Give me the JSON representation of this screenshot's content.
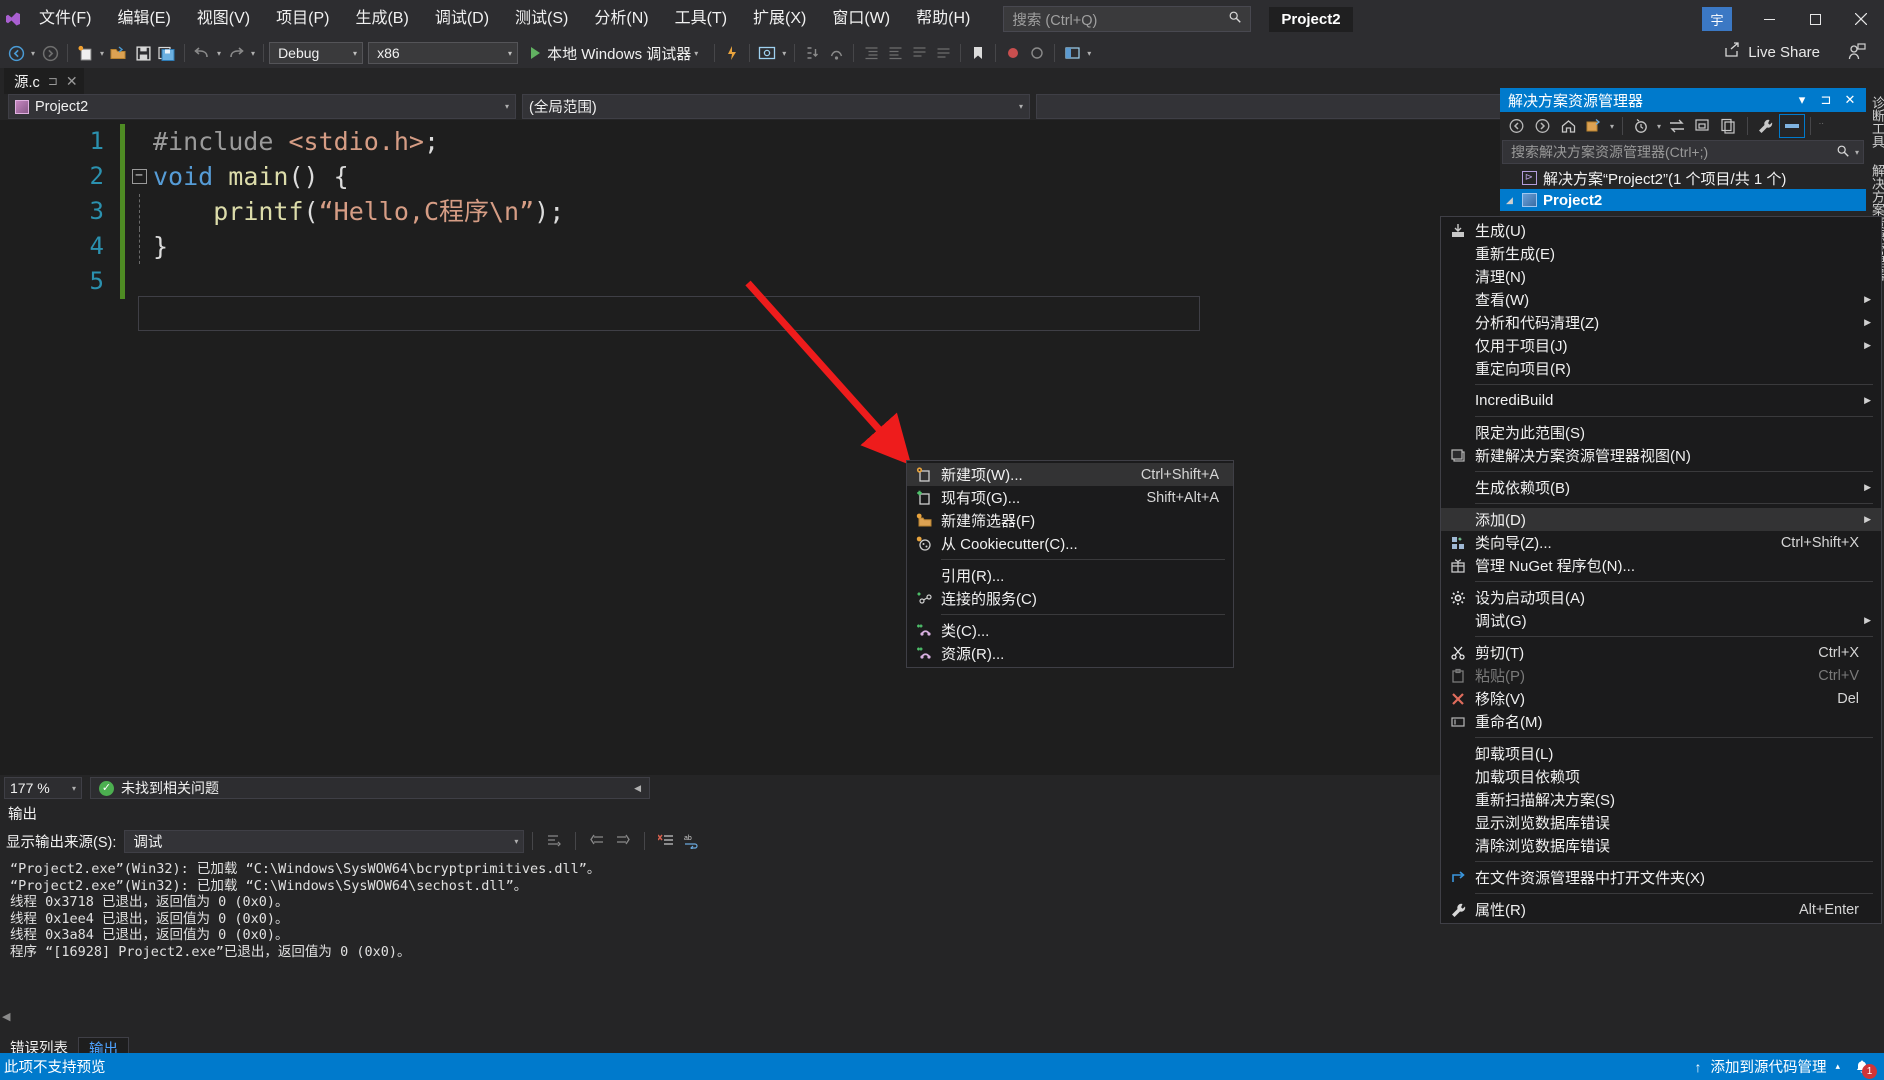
{
  "titlebar": {
    "menus": [
      "文件(F)",
      "编辑(E)",
      "视图(V)",
      "项目(P)",
      "生成(B)",
      "调试(D)",
      "测试(S)",
      "分析(N)",
      "工具(T)",
      "扩展(X)",
      "窗口(W)",
      "帮助(H)"
    ],
    "search_placeholder": "搜索 (Ctrl+Q)",
    "project_pill": "Project2",
    "user_initial": "宇",
    "minimize": "—",
    "maximize": "□",
    "close": "✕"
  },
  "toolbar": {
    "config": "Debug",
    "platform": "x86",
    "run_label": "本地 Windows 调试器",
    "live_share": "Live Share",
    "accent": "#007acc"
  },
  "editor": {
    "tab_name": "源.c",
    "nav_project": "Project2",
    "nav_scope": "(全局范围)",
    "nav_member": "",
    "lines": [
      {
        "num": "1",
        "fold": "",
        "indent": false,
        "tokens": [
          {
            "t": "#include ",
            "c": "c-pp"
          },
          {
            "t": "<stdio.h>",
            "c": "c-inc"
          },
          {
            "t": ";",
            "c": "c-plain"
          }
        ]
      },
      {
        "num": "2",
        "fold": "minus",
        "indent": false,
        "tokens": [
          {
            "t": "void",
            "c": "c-kw"
          },
          {
            "t": " ",
            "c": "c-plain"
          },
          {
            "t": "main",
            "c": "c-fn"
          },
          {
            "t": "() {",
            "c": "c-plain"
          }
        ]
      },
      {
        "num": "3",
        "fold": "",
        "indent": true,
        "tokens": [
          {
            "t": "    ",
            "c": "c-plain"
          },
          {
            "t": "printf",
            "c": "c-fn"
          },
          {
            "t": "(",
            "c": "c-plain"
          },
          {
            "t": "“Hello,C程序\\n”",
            "c": "c-str"
          },
          {
            "t": ");",
            "c": "c-plain"
          }
        ]
      },
      {
        "num": "4",
        "fold": "",
        "indent": true,
        "tokens": [
          {
            "t": "}",
            "c": "c-plain"
          }
        ]
      },
      {
        "num": "5",
        "fold": "",
        "indent": false,
        "tokens": []
      }
    ],
    "zoom_level": "177 %",
    "issues_text": "未找到相关问题",
    "ok_mark": "✓"
  },
  "output": {
    "title": "输出",
    "source_label": "显示输出来源(S):",
    "source_value": "调试",
    "lines": [
      "“Project2.exe”(Win32): 已加载 “C:\\Windows\\SysWOW64\\bcryptprimitives.dll”。",
      "“Project2.exe”(Win32): 已加载 “C:\\Windows\\SysWOW64\\sechost.dll”。",
      "线程 0x3718 已退出，返回值为 0 (0x0)。",
      "线程 0x1ee4 已退出，返回值为 0 (0x0)。",
      "线程 0x3a84 已退出，返回值为 0 (0x0)。",
      "程序 “[16928] Project2.exe”已退出，返回值为 0 (0x0)。"
    ],
    "tabs": [
      {
        "label": "错误列表",
        "active": false
      },
      {
        "label": "输出",
        "active": true
      }
    ]
  },
  "solution_explorer": {
    "title": "解决方案资源管理器",
    "search_placeholder": "搜索解决方案资源管理器(Ctrl+;)",
    "solution_row": "解决方案“Project2”(1 个项目/共 1 个)",
    "project_row": "Project2",
    "header_buttons": [
      "chevron-down-icon",
      "pin-icon",
      "close-icon"
    ]
  },
  "vertical_tabs": [
    "诊断工具",
    "解决方案资源管理器"
  ],
  "context_menu": {
    "items": [
      {
        "label": "生成(U)",
        "key": "",
        "icon": "build-icon",
        "submenu": false,
        "disabled": false,
        "hl": false
      },
      {
        "label": "重新生成(E)",
        "key": "",
        "icon": "",
        "submenu": false,
        "disabled": false,
        "hl": false
      },
      {
        "label": "清理(N)",
        "key": "",
        "icon": "",
        "submenu": false,
        "disabled": false,
        "hl": false
      },
      {
        "label": "查看(W)",
        "key": "",
        "icon": "",
        "submenu": true,
        "disabled": false,
        "hl": false
      },
      {
        "label": "分析和代码清理(Z)",
        "key": "",
        "icon": "",
        "submenu": true,
        "disabled": false,
        "hl": false
      },
      {
        "label": "仅用于项目(J)",
        "key": "",
        "icon": "",
        "submenu": true,
        "disabled": false,
        "hl": false
      },
      {
        "label": "重定向项目(R)",
        "key": "",
        "icon": "",
        "submenu": false,
        "disabled": false,
        "hl": false
      },
      {
        "separator": true
      },
      {
        "label": "IncrediBuild",
        "key": "",
        "icon": "",
        "submenu": true,
        "disabled": false,
        "hl": false
      },
      {
        "separator": true
      },
      {
        "label": "限定为此范围(S)",
        "key": "",
        "icon": "",
        "submenu": false,
        "disabled": false,
        "hl": false
      },
      {
        "label": "新建解决方案资源管理器视图(N)",
        "key": "",
        "icon": "new-view-icon",
        "submenu": false,
        "disabled": false,
        "hl": false
      },
      {
        "separator": true
      },
      {
        "label": "生成依赖项(B)",
        "key": "",
        "icon": "",
        "submenu": true,
        "disabled": false,
        "hl": false
      },
      {
        "separator": true
      },
      {
        "label": "添加(D)",
        "key": "",
        "icon": "",
        "submenu": true,
        "disabled": false,
        "hl": true
      },
      {
        "label": "类向导(Z)...",
        "key": "Ctrl+Shift+X",
        "icon": "class-wizard-icon",
        "submenu": false,
        "disabled": false,
        "hl": false
      },
      {
        "label": "管理 NuGet 程序包(N)...",
        "key": "",
        "icon": "nuget-icon",
        "submenu": false,
        "disabled": false,
        "hl": false
      },
      {
        "separator": true
      },
      {
        "label": "设为启动项目(A)",
        "key": "",
        "icon": "gear-icon",
        "submenu": false,
        "disabled": false,
        "hl": false
      },
      {
        "label": "调试(G)",
        "key": "",
        "icon": "",
        "submenu": true,
        "disabled": false,
        "hl": false
      },
      {
        "separator": true
      },
      {
        "label": "剪切(T)",
        "key": "Ctrl+X",
        "icon": "scissors-icon",
        "submenu": false,
        "disabled": false,
        "hl": false
      },
      {
        "label": "粘贴(P)",
        "key": "Ctrl+V",
        "icon": "clipboard-icon",
        "submenu": false,
        "disabled": true,
        "hl": false
      },
      {
        "label": "移除(V)",
        "key": "Del",
        "icon": "remove-x-icon",
        "submenu": false,
        "disabled": false,
        "hl": false
      },
      {
        "label": "重命名(M)",
        "key": "",
        "icon": "rename-icon",
        "submenu": false,
        "disabled": false,
        "hl": false
      },
      {
        "separator": true
      },
      {
        "label": "卸载项目(L)",
        "key": "",
        "icon": "",
        "submenu": false,
        "disabled": false,
        "hl": false
      },
      {
        "label": "加载项目依赖项",
        "key": "",
        "icon": "",
        "submenu": false,
        "disabled": false,
        "hl": false
      },
      {
        "label": "重新扫描解决方案(S)",
        "key": "",
        "icon": "",
        "submenu": false,
        "disabled": false,
        "hl": false
      },
      {
        "label": "显示浏览数据库错误",
        "key": "",
        "icon": "",
        "submenu": false,
        "disabled": false,
        "hl": false
      },
      {
        "label": "清除浏览数据库错误",
        "key": "",
        "icon": "",
        "submenu": false,
        "disabled": false,
        "hl": false
      },
      {
        "separator": true
      },
      {
        "label": "在文件资源管理器中打开文件夹(X)",
        "key": "",
        "icon": "open-folder-icon",
        "submenu": false,
        "disabled": false,
        "hl": false
      },
      {
        "separator": true
      },
      {
        "label": "属性(R)",
        "key": "Alt+Enter",
        "icon": "wrench-icon",
        "submenu": false,
        "disabled": false,
        "hl": false
      }
    ]
  },
  "submenu": {
    "items": [
      {
        "label": "新建项(W)...",
        "key": "Ctrl+Shift+A",
        "icon": "new-item-icon",
        "hl": true
      },
      {
        "label": "现有项(G)...",
        "key": "Shift+Alt+A",
        "icon": "existing-item-icon",
        "hl": false
      },
      {
        "label": "新建筛选器(F)",
        "key": "",
        "icon": "new-filter-icon",
        "hl": false
      },
      {
        "label": "从 Cookiecutter(C)...",
        "key": "",
        "icon": "cookiecutter-icon",
        "hl": false
      },
      {
        "separator": true
      },
      {
        "label": "引用(R)...",
        "key": "",
        "icon": "",
        "hl": false
      },
      {
        "label": "连接的服务(C)",
        "key": "",
        "icon": "connected-services-icon",
        "hl": false
      },
      {
        "separator": true
      },
      {
        "label": "类(C)...",
        "key": "",
        "icon": "class-icon",
        "hl": false
      },
      {
        "label": "资源(R)...",
        "key": "",
        "icon": "resource-icon",
        "hl": false
      }
    ]
  },
  "statusbar": {
    "message": "此项不支持预览",
    "scm_label": "添加到源代码管理",
    "notification_count": "1"
  }
}
